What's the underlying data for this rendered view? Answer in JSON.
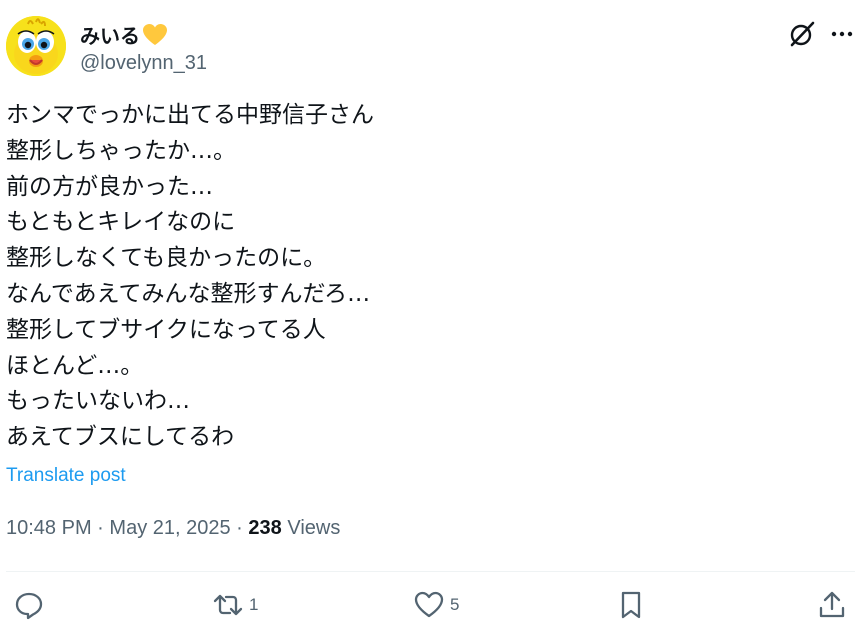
{
  "user": {
    "display_name": "みいる",
    "handle": "@lovelynn_31",
    "name_emoji": "yellow-heart-icon",
    "avatar": "avatar-yellow-bird"
  },
  "post": {
    "text": "ホンマでっかに出てる中野信子さん\n整形しちゃったか…。\n前の方が良かった…\nもともとキレイなのに\n整形しなくても良かったのに。\nなんであえてみんな整形すんだろ…\n整形してブサイクになってる人\nほとんど…。\nもったいないわ…\nあえてブスにしてるわ",
    "translate_label": "Translate post",
    "time": "10:48 PM",
    "date": "May 21, 2025",
    "separator": "·",
    "views_count": "238",
    "views_label": "Views"
  },
  "actions": {
    "reply_count": "",
    "repost_count": "1",
    "like_count": "5"
  },
  "colors": {
    "primary_text": "#0f1419",
    "secondary_text": "#536471",
    "link": "#1d9bf0",
    "divider": "#eff3f4",
    "heart_emoji": "#ffc83d"
  }
}
